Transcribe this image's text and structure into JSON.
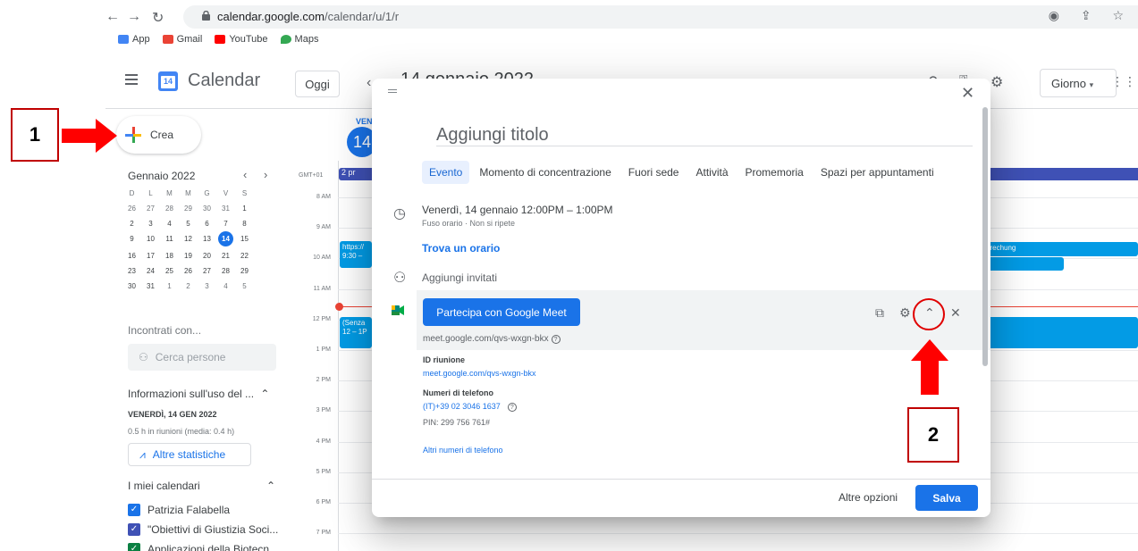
{
  "browser": {
    "url_domain": "calendar.google.com",
    "url_path": "/calendar/u/1/r",
    "bookmarks": [
      {
        "label": "App",
        "color": "#fbbc04"
      },
      {
        "label": "Gmail",
        "color": "#ea4335"
      },
      {
        "label": "YouTube",
        "color": "#ff0000"
      },
      {
        "label": "Maps",
        "color": "#34a853"
      }
    ]
  },
  "header": {
    "app_name": "Calendar",
    "logo_day": "14",
    "today_label": "Oggi",
    "date_title": "14 gennaio 2022",
    "view_label": "Giorno"
  },
  "sidebar": {
    "create_label": "Crea",
    "mini_month": "Gennaio 2022",
    "weekdays": [
      "D",
      "L",
      "M",
      "M",
      "G",
      "V",
      "S"
    ],
    "weeks": [
      [
        "26",
        "27",
        "28",
        "29",
        "30",
        "31",
        "1"
      ],
      [
        "2",
        "3",
        "4",
        "5",
        "6",
        "7",
        "8"
      ],
      [
        "9",
        "10",
        "11",
        "12",
        "13",
        "14",
        "15"
      ],
      [
        "16",
        "17",
        "18",
        "19",
        "20",
        "21",
        "22"
      ],
      [
        "23",
        "24",
        "25",
        "26",
        "27",
        "28",
        "29"
      ],
      [
        "30",
        "31",
        "1",
        "2",
        "3",
        "4",
        "5"
      ]
    ],
    "selected_day": "14",
    "meet_with": "Incontrati con...",
    "search_people_placeholder": "Cerca persone",
    "usage_title": "Informazioni sull'uso del ...",
    "usage_date": "VENERDÌ, 14 GEN 2022",
    "usage_stats": "0.5 h in riunioni (media: 0.4 h)",
    "more_stats": "Altre statistiche",
    "my_calendars": "I miei calendari",
    "calendars": [
      {
        "name": "Patrizia Falabella",
        "color": "#1a73e8"
      },
      {
        "name": "\"Obiettivi di Giustizia Soci...",
        "color": "#3f51b5"
      },
      {
        "name": "Applicazioni della Biotecn...",
        "color": "#0b8043"
      }
    ]
  },
  "grid": {
    "day_of_week": "VEN",
    "day_number": "14",
    "timezone": "GMT+01",
    "allday_event": "2 pr",
    "hours": [
      "8 AM",
      "9 AM",
      "10 AM",
      "11 AM",
      "12 PM",
      "1 PM",
      "2 PM",
      "3 PM",
      "4 PM",
      "5 PM",
      "6 PM",
      "7 PM"
    ],
    "events": [
      {
        "title": "https://",
        "time": "9:30 –"
      },
      {
        "title": "(Senza",
        "time": "12 – 1P"
      },
      {
        "title": "prechung",
        "time": ""
      }
    ]
  },
  "dialog": {
    "title_placeholder": "Aggiungi titolo",
    "tabs": [
      "Evento",
      "Momento di concentrazione",
      "Fuori sede",
      "Attività",
      "Promemoria",
      "Spazi per appuntamenti"
    ],
    "datetime": "Venerdì, 14 gennaio   12:00PM  –  1:00PM",
    "datetime_sub": "Fuso orario · Non si ripete",
    "find_time": "Trova un orario",
    "add_guests": "Aggiungi invitati",
    "meet_button": "Partecipa con Google Meet",
    "meet_link": "meet.google.com/qvs-wxgn-bkx",
    "meeting_id_label": "ID riunione",
    "meeting_id_link": "meet.google.com/qvs-wxgn-bkx",
    "phone_label": "Numeri di telefono",
    "phone_number": "(IT)+39 02 3046 1637",
    "pin": "PIN: 299 756 761#",
    "more_numbers": "Altri numeri di telefono",
    "more_options": "Altre opzioni",
    "save": "Salva"
  },
  "annotations": {
    "step1": "1",
    "step2": "2",
    "color": "#ff0000"
  }
}
